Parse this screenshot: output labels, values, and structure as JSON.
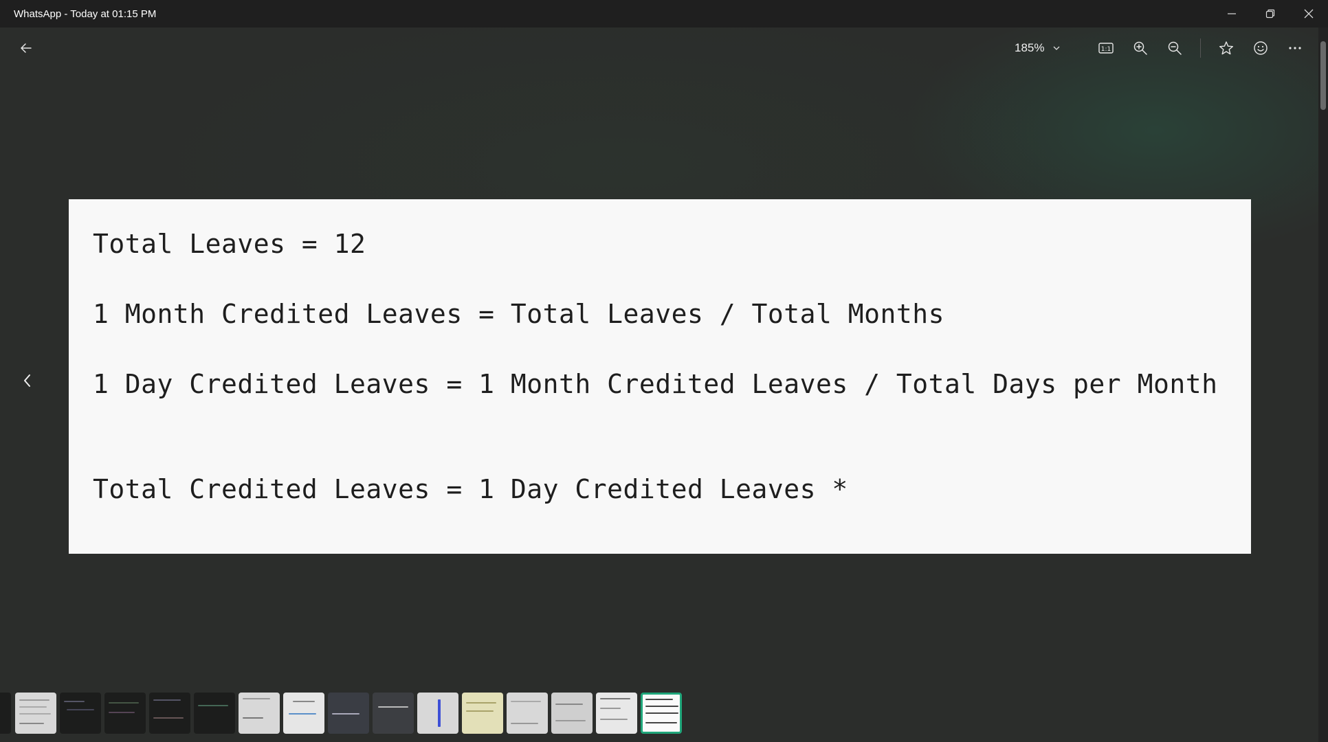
{
  "window": {
    "title": "WhatsApp - Today at 01:15 PM"
  },
  "toolbar": {
    "zoom_value": "185%"
  },
  "image": {
    "lines": [
      "Total Leaves = 12",
      "1 Month Credited Leaves = Total Leaves / Total Months",
      "1 Day Credited Leaves = 1 Month Credited Leaves / Total Days per Month",
      "Total Credited Leaves = 1 Day Credited Leaves *"
    ]
  },
  "filmstrip": {
    "active_index": 14,
    "count": 15
  },
  "colors": {
    "titlebar": "#1f1f1f",
    "background": "#2b2d2b",
    "accent": "#1fa67a",
    "card": "#f8f8f8"
  },
  "icons": [
    "minimize-icon",
    "restore-icon",
    "close-icon",
    "back-arrow-icon",
    "chevron-down-icon",
    "actual-size-icon",
    "zoom-in-icon",
    "zoom-out-icon",
    "star-icon",
    "smiley-icon",
    "more-icon",
    "chevron-left-icon"
  ]
}
